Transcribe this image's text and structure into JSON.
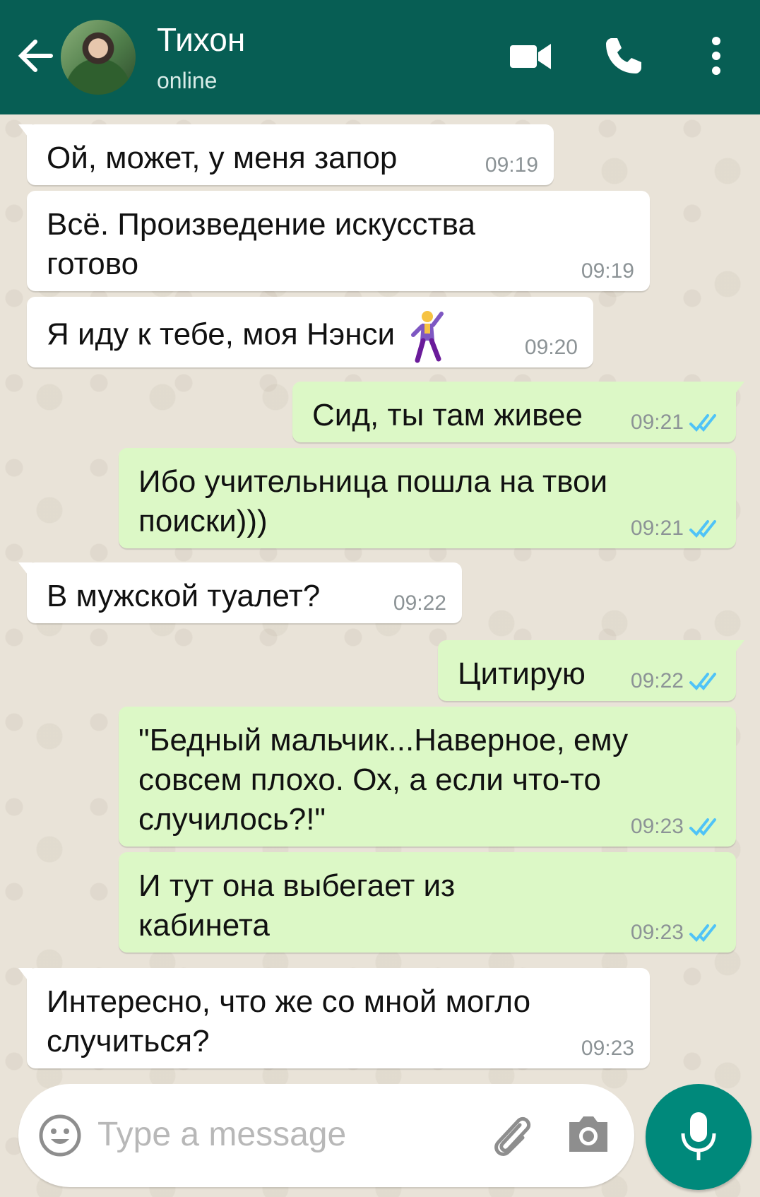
{
  "header": {
    "contact_name": "Тихон",
    "status": "online",
    "colors": {
      "bar": "#075e54",
      "outgoing": "#dcf8c6",
      "incoming": "#ffffff",
      "ticks": "#4fc3f7"
    }
  },
  "messages": [
    {
      "direction": "in",
      "text": "Ой, может, у меня запор",
      "time": "09:19"
    },
    {
      "direction": "in",
      "text": "Всё. Произведение искусства готово",
      "time": "09:19"
    },
    {
      "direction": "in",
      "text": "Я иду к тебе, моя Нэнси",
      "emoji": "dancing-man-emoji",
      "time": "09:20"
    },
    {
      "direction": "out",
      "text": "Сид, ты там живее",
      "time": "09:21",
      "read": true
    },
    {
      "direction": "out",
      "text": "Ибо учительница пошла на твои поиски)))",
      "time": "09:21",
      "read": true
    },
    {
      "direction": "in",
      "text": "В мужской туалет?",
      "time": "09:22"
    },
    {
      "direction": "out",
      "text": "Цитирую",
      "time": "09:22",
      "read": true
    },
    {
      "direction": "out",
      "text": "\"Бедный мальчик...Наверное, ему совсем плохо. Ох, а если что-то случилось?!\"",
      "time": "09:23",
      "read": true
    },
    {
      "direction": "out",
      "text": "И тут она выбегает из кабинета",
      "time": "09:23",
      "read": true
    },
    {
      "direction": "in",
      "text": "Интересно, что же со мной могло случиться?",
      "time": "09:23"
    }
  ],
  "composer": {
    "placeholder": "Type a message"
  }
}
